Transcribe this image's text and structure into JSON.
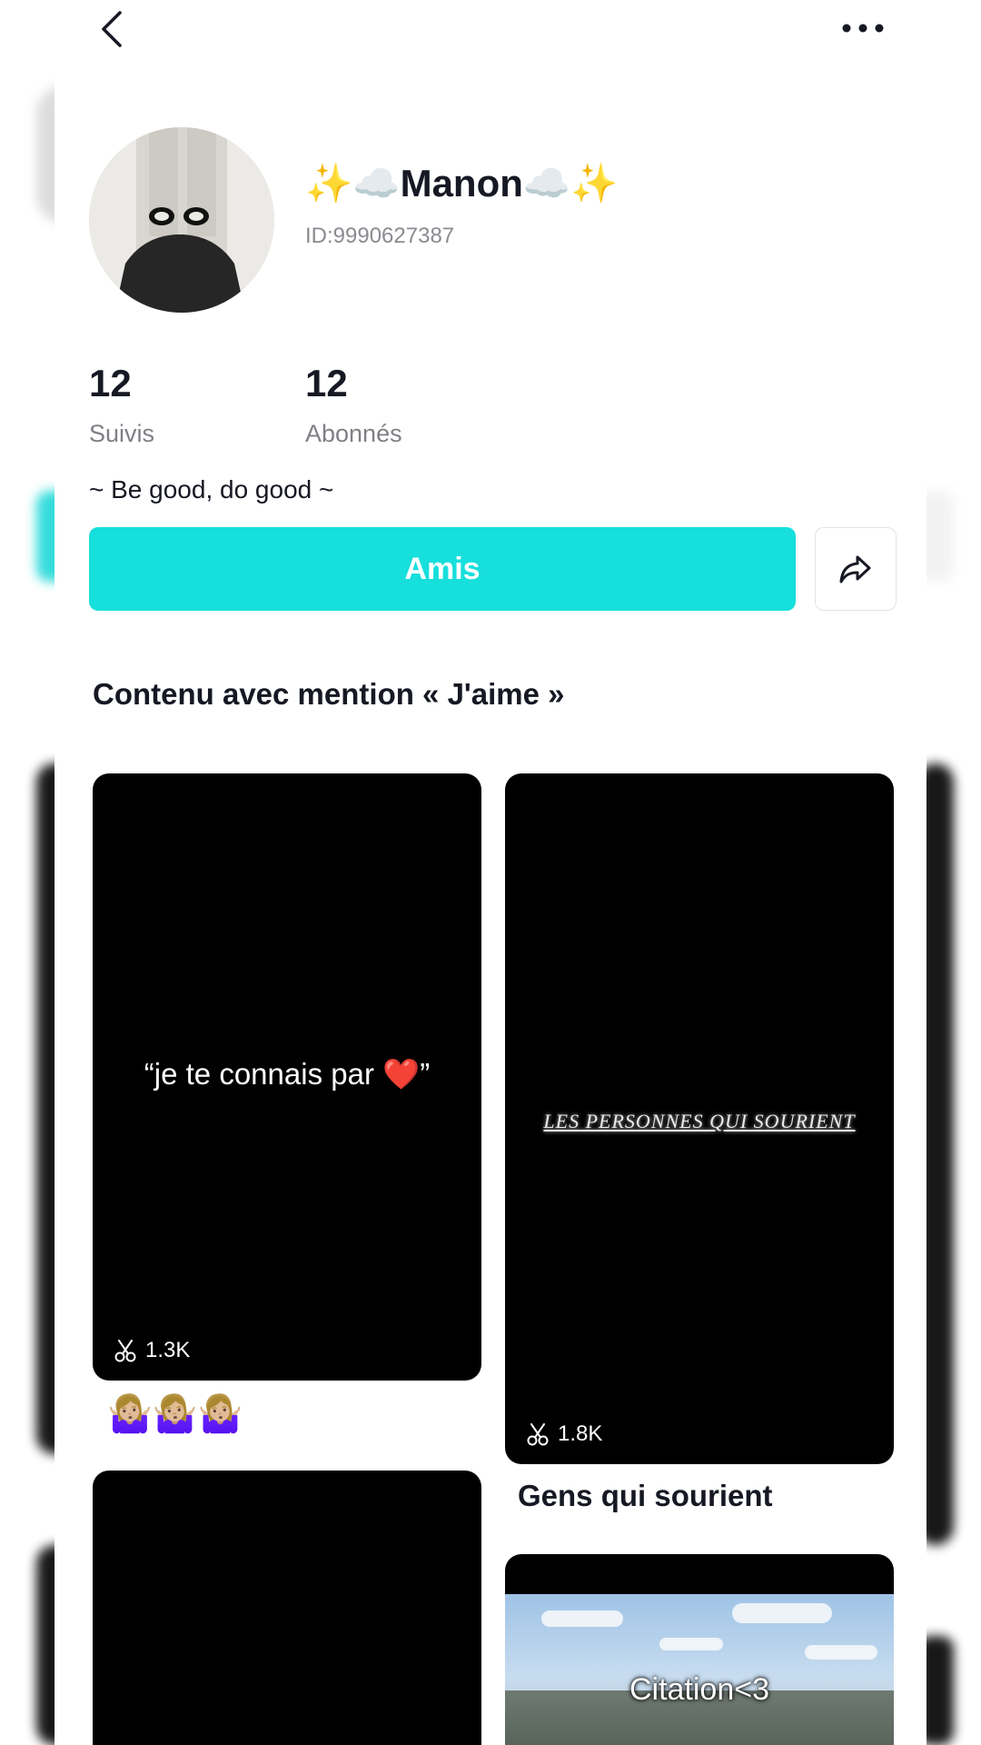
{
  "header": {
    "back_icon": "chevron-left-icon",
    "more_icon": "more-horizontal-icon"
  },
  "profile": {
    "display_name": "✨☁️Manon☁️✨",
    "user_id": "ID:9990627387",
    "bio": "~ Be good, do good ~",
    "stats": {
      "following_count": "12",
      "following_label": "Suivis",
      "followers_count": "12",
      "followers_label": "Abonnés"
    }
  },
  "actions": {
    "friends_label": "Amis",
    "share_icon": "share-arrow-icon"
  },
  "colors": {
    "accent": "#16dfdc",
    "text": "#161823",
    "muted": "#8a8b91"
  },
  "liked_section": {
    "title": "Contenu avec mention « J'aime »",
    "templates": [
      {
        "overlay_text": "“je te connais par ❤️”",
        "uses": "1.3K",
        "caption": "🤷🏼‍♀️🤷🏼‍♀️🤷🏼‍♀️",
        "uses_icon": "scissors-icon"
      },
      {
        "overlay_text": "LES PERSONNES QUI SOURIENT",
        "uses": "1.8K",
        "caption": "Gens qui sourient",
        "uses_icon": "scissors-icon"
      },
      {
        "overlay_text": ""
      },
      {
        "overlay_text": "Citation<3"
      }
    ]
  }
}
